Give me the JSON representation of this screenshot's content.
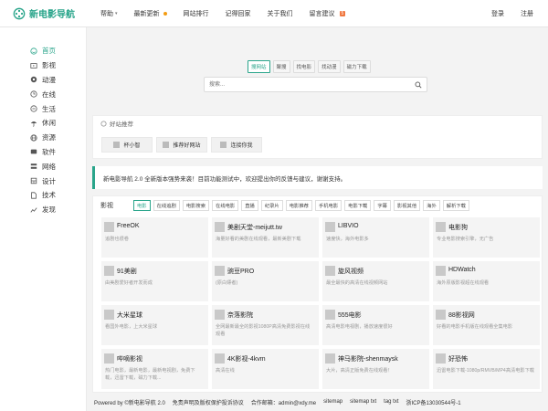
{
  "header": {
    "logo_text": "新电影导航",
    "nav": [
      {
        "label": "帮助",
        "caret": "▾"
      },
      {
        "label": "最新更新"
      },
      {
        "label": "网站排行"
      },
      {
        "label": "记得回家"
      },
      {
        "label": "关于我们"
      },
      {
        "label": "留言建议",
        "badge": "5"
      }
    ],
    "login": "登录",
    "register": "注册"
  },
  "sidebar": {
    "items": [
      {
        "label": "首页",
        "icon": "smile-icon"
      },
      {
        "label": "影视",
        "icon": "film-icon"
      },
      {
        "label": "动漫",
        "icon": "anime-icon"
      },
      {
        "label": "在线",
        "icon": "online-icon"
      },
      {
        "label": "生活",
        "icon": "life-icon"
      },
      {
        "label": "休闲",
        "icon": "leisure-icon"
      },
      {
        "label": "资源",
        "icon": "resource-icon"
      },
      {
        "label": "软件",
        "icon": "software-icon"
      },
      {
        "label": "网络",
        "icon": "network-icon"
      },
      {
        "label": "设计",
        "icon": "design-icon"
      },
      {
        "label": "技术",
        "icon": "tech-icon"
      },
      {
        "label": "发现",
        "icon": "discover-icon"
      }
    ]
  },
  "search": {
    "tabs": [
      "搜网站",
      "聚搜",
      "找电影",
      "找动漫",
      "磁力下载"
    ],
    "placeholder": "搜索..."
  },
  "recommend": {
    "title": "好站推荐",
    "buttons": [
      "杯小智",
      "推荐好网站",
      "连接你我"
    ]
  },
  "notice": "新电影导航 2.0 全新版本强势来袭！目前功能测试中，欢迎提出你的反馈与建议，谢谢支持。",
  "movies": {
    "title": "影视",
    "tabs": [
      "电影",
      "在线追剧",
      "电影搜索",
      "在线电影",
      "直播",
      "纪录片",
      "电影推荐",
      "手机电影",
      "电影下载",
      "字幕",
      "影视其他",
      "海外",
      "解析下载"
    ],
    "sites": [
      {
        "name": "FreeOK",
        "desc": "追剧也很卷"
      },
      {
        "name": "美剧天堂-meijutt.tw",
        "desc": "海量好看的美剧在线观看，最新美剧下载"
      },
      {
        "name": "LIBVIO",
        "desc": "速度快，海外电影多"
      },
      {
        "name": "电影狗",
        "desc": "专业电影搜索引擎，无广告"
      },
      {
        "name": "91美剧",
        "desc": "由美剧爱好者开发而成"
      },
      {
        "name": "豌豆PRO",
        "desc": "(原白嫖者)"
      },
      {
        "name": "旋风视频",
        "desc": "最全最快的高清在线视频网站"
      },
      {
        "name": "HDWatch",
        "desc": "海外原版影视超在线观看"
      },
      {
        "name": "大米星球",
        "desc": "看国外电影，上大米星球"
      },
      {
        "name": "奈落影院",
        "desc": "全网最新最全的影视1080P高清免费影视在线观看"
      },
      {
        "name": "555电影",
        "desc": "高清电影电视剧，播放速度很好"
      },
      {
        "name": "88影视网",
        "desc": "好看的电影手机版在线观看全集电影"
      },
      {
        "name": "哔嘀影视",
        "desc": "热门电影，最新电影，最新电视剧，免费下载，迅雷下载，磁力下载..."
      },
      {
        "name": "4K影视-4kvm",
        "desc": "高清在线"
      },
      {
        "name": "神马影院-shenmaysk",
        "desc": "大片，高清正版免费在线观看！"
      },
      {
        "name": "好恐怖",
        "desc": "迅雷电影下载-1080p/RMVB/MP4高清电影下载"
      }
    ]
  },
  "footer": {
    "copyright": "Powered by ©新电影导航 2.0",
    "disclaimer": "免责声明及版权保护投诉协议",
    "contact": "合作邮箱：admin@xdy.me",
    "sitemap": "sitemap",
    "sitemap_txt": "sitemap txt",
    "tag_txt": "tag txt",
    "icp": "浙ICP备13030544号-1"
  },
  "colors": {
    "accent": "#2aa58b",
    "badge": "#f0773f"
  }
}
